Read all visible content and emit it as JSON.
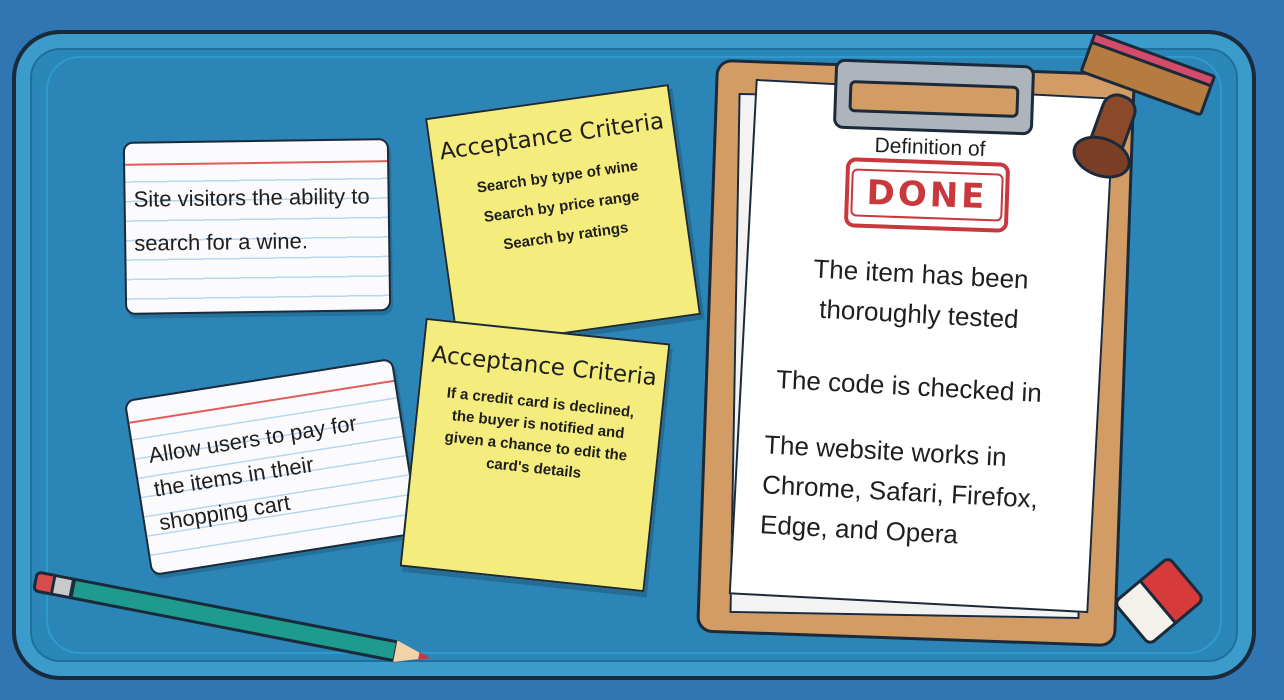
{
  "cards": [
    {
      "text": "Site visitors the ability to search for a wine."
    },
    {
      "text": "Allow users to pay for the items in their shopping cart"
    }
  ],
  "sticky_notes": [
    {
      "title": "Acceptance Criteria",
      "items": [
        "Search by type of wine",
        "Search by price range",
        "Search by ratings"
      ]
    },
    {
      "title": "Acceptance Criteria",
      "body": "If a credit card is declined, the buyer is notified and given a chance to edit the card's details"
    }
  ],
  "clipboard": {
    "heading": "Definition of",
    "stamp": "DONE",
    "items": [
      "The item has been thoroughly tested",
      "The code is checked in",
      "The website works in Chrome, Safari, Firefox, Edge, and Opera"
    ]
  },
  "colors": {
    "board": "#2a87b8",
    "sticky": "#f4ec7c",
    "stamp_red": "#c9383c",
    "clipboard": "#d49c65"
  }
}
